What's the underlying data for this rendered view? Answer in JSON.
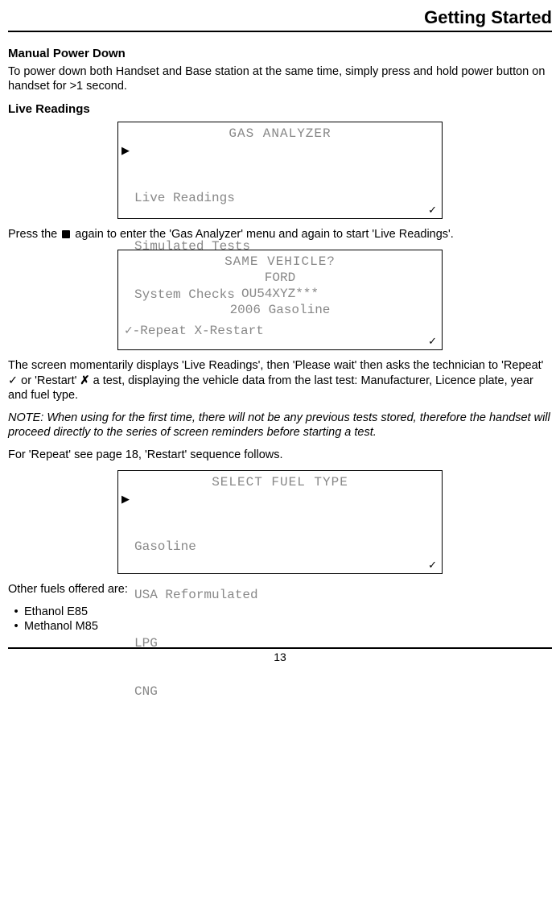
{
  "header": {
    "title": "Getting Started"
  },
  "section1": {
    "heading": "Manual Power Down",
    "body": "To power down both Handset and Base station at the same time, simply press and hold power button on handset for >1 second."
  },
  "section2": {
    "heading": "Live Readings",
    "lcd1": {
      "title": "GAS ANALYZER",
      "items": [
        "Live Readings",
        "Simulated Tests",
        "System Checks"
      ]
    },
    "para1a": "Press the ",
    "para1b": " again to enter the 'Gas Analyzer' menu and again to start 'Live Readings'.",
    "lcd2": {
      "title": "SAME VEHICLE?",
      "line1": "FORD",
      "line2": "OU54XYZ***",
      "line3": "2006  Gasoline",
      "footer": "✓-Repeat X-Restart"
    },
    "para2a": "The screen momentarily displays 'Live Readings', then 'Please wait' then asks the technician to 'Repeat' ",
    "para2b": " or 'Restart' ",
    "para2c": " a test, displaying the vehicle data from the last test: Manufacturer, Licence plate, year and fuel type.",
    "note": "NOTE: When using for the first time, there will not be any previous tests stored, therefore the handset will proceed directly to the series of screen reminders before starting a test.",
    "para3": "For 'Repeat' see page 18, 'Restart' sequence follows.",
    "lcd3": {
      "title": "SELECT FUEL TYPE",
      "items": [
        "Gasoline",
        "USA Reformulated",
        "LPG",
        "CNG"
      ]
    },
    "para4": "Other fuels offered are:",
    "bullets": [
      "Ethanol E85",
      "Methanol M85"
    ]
  },
  "footer": {
    "page": "13"
  }
}
